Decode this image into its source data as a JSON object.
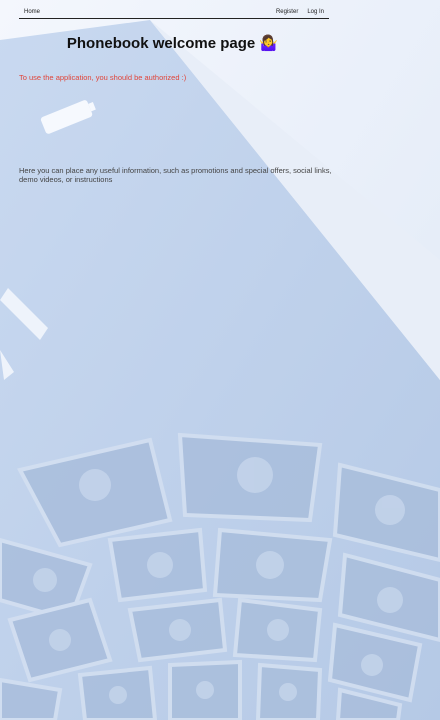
{
  "nav": {
    "home": "Home",
    "register": "Register",
    "login": "Log In"
  },
  "page": {
    "title": "Phonebook welcome page",
    "title_emoji": "🤷‍♀️",
    "auth_notice": "To use the application, you should be authorized :)",
    "info_text": "Here you can place any useful information, such as promotions and special offers, social links, demo videos, or instructions"
  },
  "colors": {
    "warning": "#e0453a",
    "nav_border": "#222222",
    "background": "#e9f0fb"
  }
}
